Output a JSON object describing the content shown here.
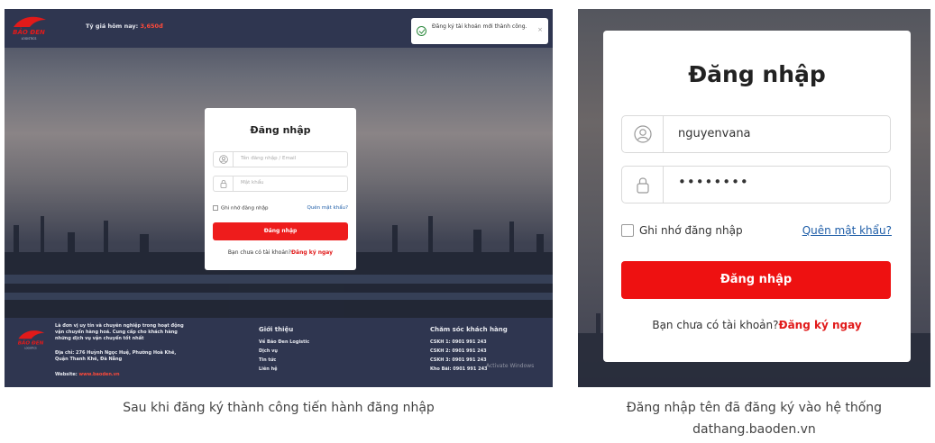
{
  "left_shot": {
    "brand": "BẢO ĐEN",
    "brand_sub": "LOGISTICS",
    "rate_label": "Tỷ giá hôm nay:",
    "rate_value": "3,650đ",
    "toast_message": "Đăng ký tài khoản mới thành công.",
    "toast_close": "×",
    "login": {
      "title": "Đăng nhập",
      "username_placeholder": "Tên đăng nhập / Email",
      "password_placeholder": "Mật khẩu",
      "remember_label": "Ghi nhớ đăng nhập",
      "forgot_label": "Quên mật khẩu?",
      "submit_label": "Đăng nhập",
      "register_prompt": "Bạn chưa có tài khoản?",
      "register_link": "Đăng ký ngay"
    },
    "footer": {
      "about": "Là đơn vị uy tín và chuyên nghiệp trong hoạt động vận chuyển hàng hoá. Cung cấp cho khách hàng những dịch vụ vận chuyển tốt nhất",
      "address": "Địa chỉ: 276 Huỳnh Ngọc Huệ, Phường Hoà Khê, Quận Thanh Khê, Đà Nẵng",
      "website_label": "Website:",
      "website_value": "www.baoden.vn",
      "intro_heading": "Giới thiệu",
      "intro_links": [
        "Về Bảo Đen Logistic",
        "Dịch vụ",
        "Tin tức",
        "Liên hệ"
      ],
      "care_heading": "Chăm sóc khách hàng",
      "care_lines": [
        "CSKH 1: 0901 991 243",
        "CSKH 2: 0901 991 243",
        "CSKH 3: 0901 991 243",
        "Kho Bãi: 0901 991 243"
      ],
      "watermark": "Activate Windows"
    }
  },
  "right_shot": {
    "title": "Đăng nhập",
    "username_value": "nguyenvana",
    "password_value": "••••••••",
    "remember_label": "Ghi nhớ đăng nhập",
    "forgot_label": "Quên mật khẩu?",
    "submit_label": "Đăng nhập",
    "register_prompt": "Bạn chưa có tài khoản?",
    "register_link": "Đăng ký ngay"
  },
  "captions": {
    "left": "Sau khi đăng ký thành công tiến hành đăng nhập",
    "right": "Đăng nhập tên đã đăng ký vào hệ thống dathang.baoden.vn"
  },
  "colors": {
    "brand_red": "#ee1c1c",
    "navy": "#2f3650",
    "link_blue": "#1f5ea8"
  }
}
